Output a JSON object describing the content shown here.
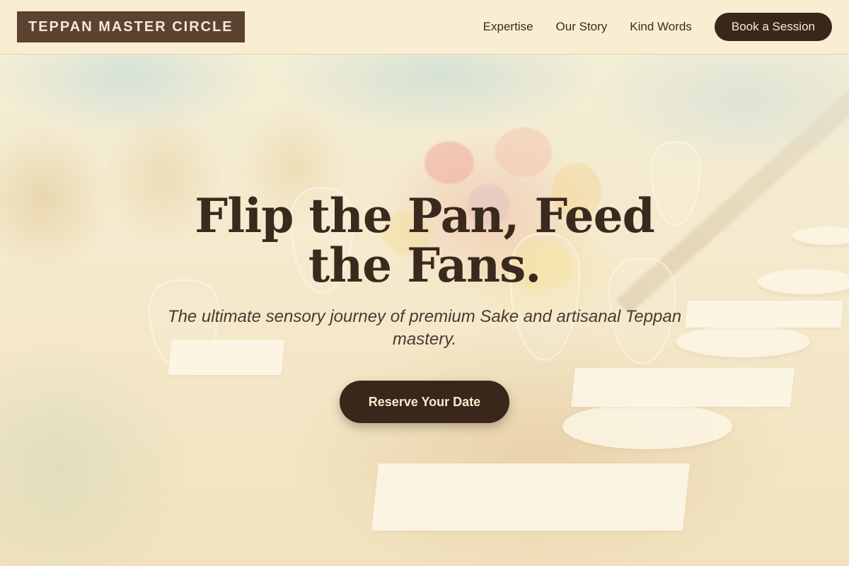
{
  "header": {
    "logo_text": "TEPPAN MASTER CIRCLE",
    "nav": [
      {
        "label": "Expertise"
      },
      {
        "label": "Our Story"
      },
      {
        "label": "Kind Words"
      }
    ],
    "book_label": "Book a Session"
  },
  "hero": {
    "headline": "Flip the Pan, Feed the Fans.",
    "subtitle": "The ultimate sensory journey of premium Sake and artisanal Teppan mastery.",
    "cta_label": "Reserve Your Date"
  },
  "colors": {
    "primary_dark": "#3a271c",
    "logo_bg": "#5b4231",
    "cream": "#f9edd2",
    "text": "#3a2a1e"
  }
}
